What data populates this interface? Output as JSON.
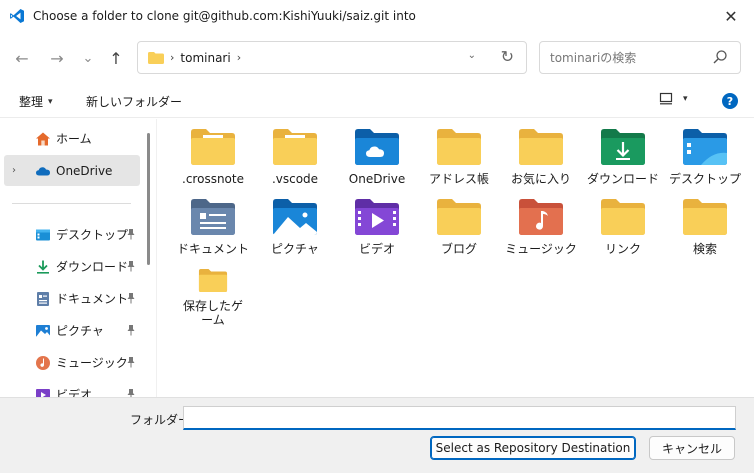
{
  "window": {
    "title": "Choose a folder to clone git@github.com:KishiYuuki/saiz.git into",
    "close_glyph": "✕"
  },
  "nav": {
    "back_glyph": "←",
    "forward_glyph": "→",
    "recent_glyph": "⌄",
    "up_glyph": "↑",
    "breadcrumb": "tominari",
    "crumb_sep": "›",
    "dropdown_glyph": "⌄",
    "refresh_glyph": "↻"
  },
  "search": {
    "placeholder": "tominariの検索"
  },
  "toolbar": {
    "organize_label": "整理",
    "new_folder_label": "新しいフォルダー",
    "caret": "▾",
    "help_label": "?"
  },
  "sidebar": {
    "items": [
      {
        "label": "ホーム",
        "icon": "home-icon"
      },
      {
        "label": "OneDrive",
        "icon": "onedrive-icon",
        "expander": "›"
      },
      {
        "label": "デスクトップ",
        "icon": "desktop-icon"
      },
      {
        "label": "ダウンロード",
        "icon": "download-icon"
      },
      {
        "label": "ドキュメント",
        "icon": "documents-icon"
      },
      {
        "label": "ピクチャ",
        "icon": "pictures-icon"
      },
      {
        "label": "ミュージック",
        "icon": "music-icon"
      },
      {
        "label": "ビデオ",
        "icon": "videos-icon"
      }
    ],
    "pin_glyph": "📌"
  },
  "files": [
    {
      "name": ".crossnote",
      "icon": "folder-doc-icon"
    },
    {
      "name": ".vscode",
      "icon": "folder-doc-icon"
    },
    {
      "name": "OneDrive",
      "icon": "onedrive-folder-icon"
    },
    {
      "name": "アドレス帳",
      "icon": "folder-icon"
    },
    {
      "name": "お気に入り",
      "icon": "folder-icon"
    },
    {
      "name": "ダウンロード",
      "icon": "downloads-folder-icon"
    },
    {
      "name": "デスクトップ",
      "icon": "desktop-folder-icon"
    },
    {
      "name": "ドキュメント",
      "icon": "documents-folder-icon"
    },
    {
      "name": "ピクチャ",
      "icon": "pictures-folder-icon"
    },
    {
      "name": "ビデオ",
      "icon": "videos-folder-icon"
    },
    {
      "name": "ブログ",
      "icon": "folder-icon"
    },
    {
      "name": "ミュージック",
      "icon": "music-folder-icon"
    },
    {
      "name": "リンク",
      "icon": "folder-icon"
    },
    {
      "name": "検索",
      "icon": "folder-icon"
    },
    {
      "name": "保存したゲーム",
      "icon": "folder-icon"
    }
  ],
  "footer": {
    "folder_label": "フォルダー:",
    "folder_value": "",
    "select_button": "Select as Repository Destination",
    "cancel_button": "キャンセル"
  },
  "colors": {
    "accent": "#0067c0",
    "folder_yellow": "#f9cf58",
    "folder_back": "#e9b23e"
  }
}
